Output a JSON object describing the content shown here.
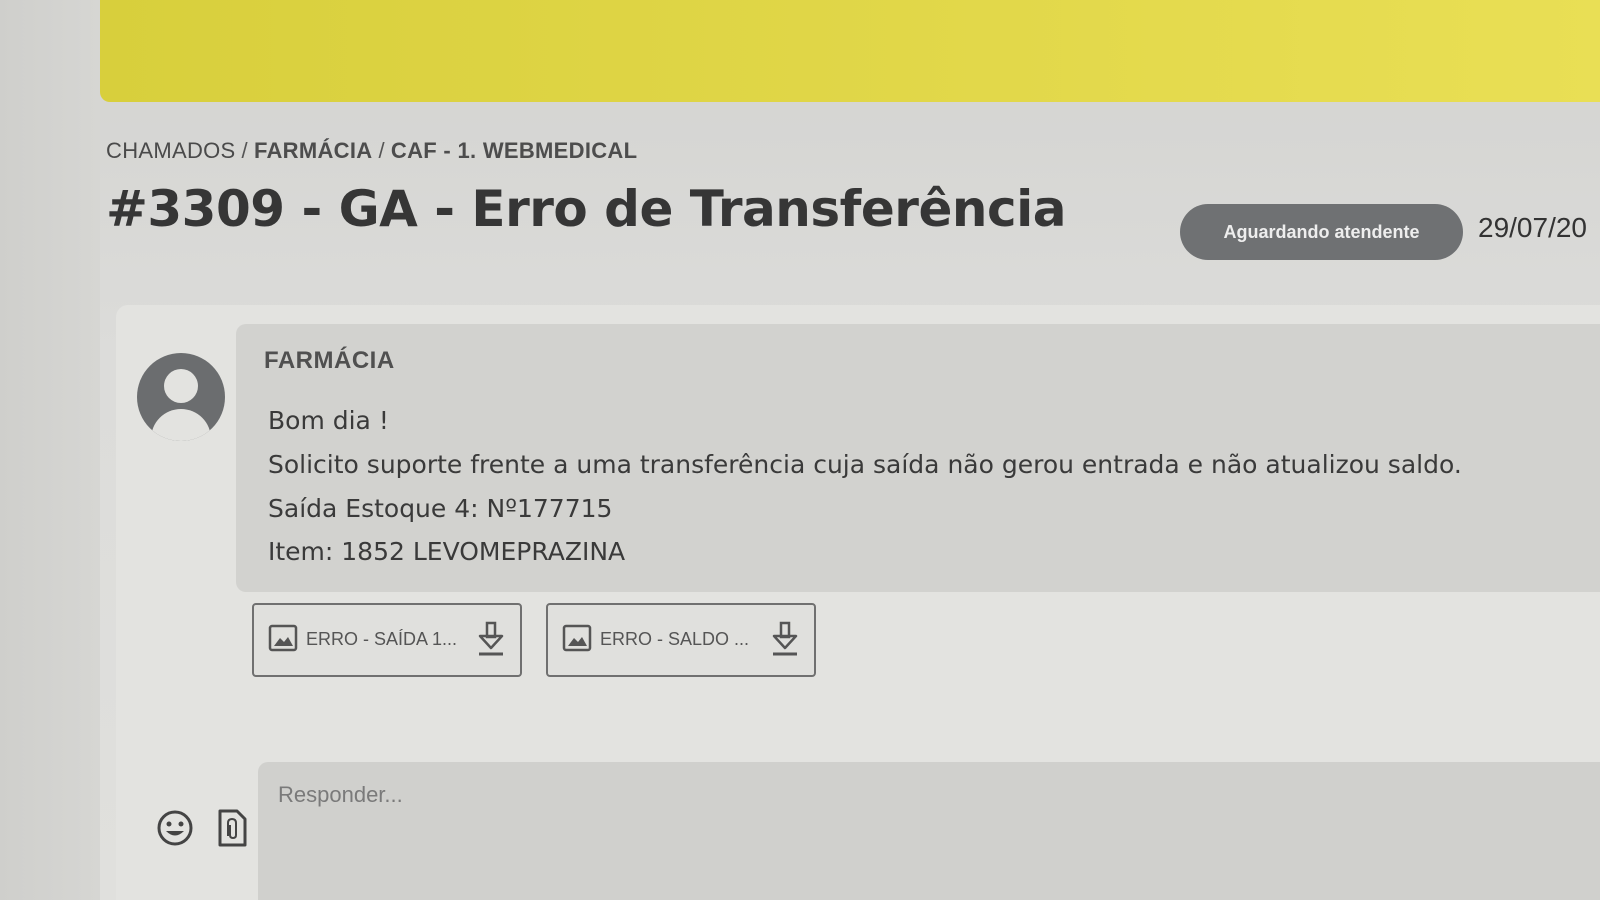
{
  "breadcrumb": {
    "root": "CHAMADOS",
    "separator": "/",
    "level1": "FARMÁCIA",
    "level2": "CAF - 1. WEBMEDICAL"
  },
  "ticket": {
    "title": "#3309 - GA - Erro de Transferência",
    "status": "Aguardando atendente",
    "date": "29/07/20"
  },
  "message": {
    "sender": "FARMÁCIA",
    "lines": [
      "Bom dia !",
      "Solicito suporte frente a uma transferência cuja saída não gerou entrada e não atualizou saldo.",
      "Saída Estoque 4: Nº177715",
      "Item: 1852 LEVOMEPRAZINA"
    ],
    "attachments": [
      {
        "name": "ERRO - SAÍDA 1...",
        "icon": "image-icon",
        "action_icon": "download-icon"
      },
      {
        "name": "ERRO - SALDO ...",
        "icon": "image-icon",
        "action_icon": "download-icon"
      }
    ]
  },
  "reply": {
    "placeholder": "Responder...",
    "emoji_icon": "emoji-icon",
    "attach_icon": "attach-file-icon"
  },
  "colors": {
    "banner": "#e2d84a",
    "status_badge": "#6f7173"
  }
}
